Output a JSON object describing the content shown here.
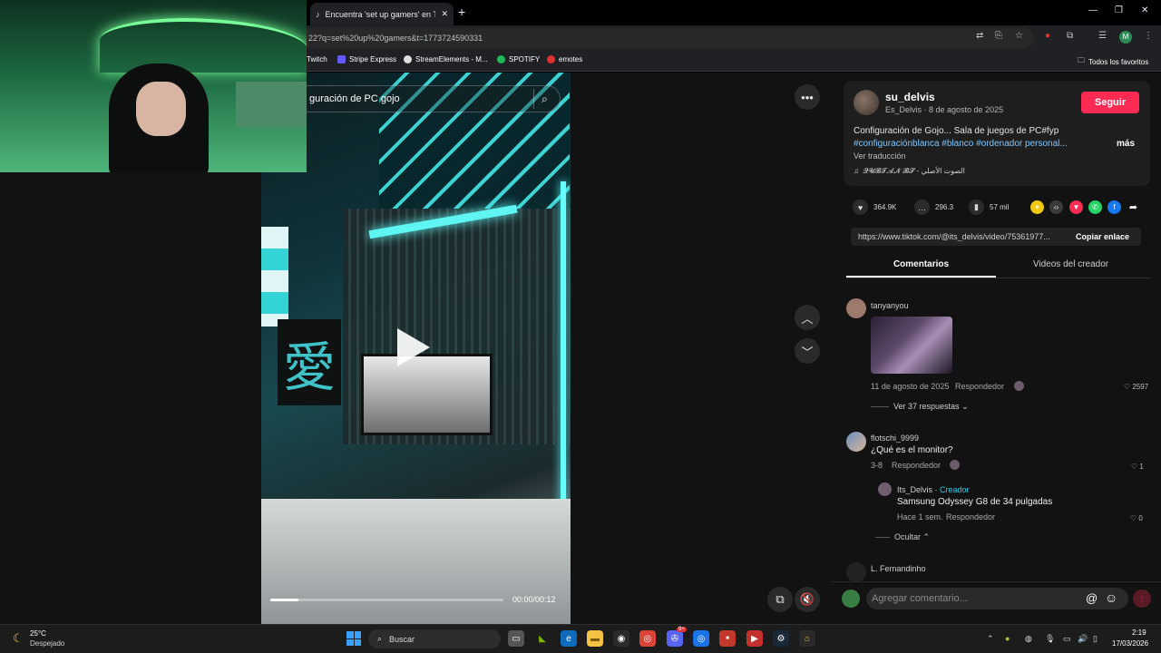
{
  "browser": {
    "tab_title": "Encuentra 'set up gamers' en Ti",
    "tab_close": "✕",
    "new_tab": "+",
    "window_controls": {
      "minimize": "—",
      "maximize": "❐",
      "close": "✕"
    },
    "url": "22?q=set%20up%20gamers&t=1773724590331",
    "bookmarks": [
      {
        "label": "Twitch",
        "color": "#9146ff"
      },
      {
        "label": "Stripe Express",
        "color": "#635bff"
      },
      {
        "label": "StreamElements - M...",
        "color": "#e0e0e0"
      },
      {
        "label": "SPOTIFY",
        "color": "#1db954"
      },
      {
        "label": "emotes",
        "color": "#e03030"
      }
    ],
    "all_favorites": "Todos los favoritos",
    "profile_initial": "M"
  },
  "video": {
    "search_text": "guración de PC gojo",
    "poster_glyph": "愛",
    "progress": 0.12,
    "time": "00:00/00:12"
  },
  "post": {
    "username": "su_delvis",
    "handle": "Es_Delvis",
    "date": "8 de agosto de 2025",
    "follow_label": "Seguir",
    "description_line1": "Configuración de Gojo... Sala de juegos de PC#fyp",
    "description_line2": "#configuraciónblanca #blanco #ordenador personal...",
    "more": "más",
    "translate": "Ver traducción",
    "music_note": "♫",
    "music": "𝓠𝓤𝓑𝓣𝓐𝓝 𝓑𝓢 - الصوت الأصلي",
    "likes": "364.9K",
    "comments": "296.3",
    "saves": "57 mil",
    "link": "https://www.tiktok.com/@its_delvis/video/75361977...",
    "copy_link": "Copiar enlace",
    "tab_comments": "Comentarios",
    "tab_videos": "Videos del creador"
  },
  "comments": [
    {
      "user": "tanyanyou",
      "date": "11 de agosto de 2025",
      "reply": "Respondedor",
      "likes": "2597",
      "view_replies": "Ver 37 respuestas"
    },
    {
      "user": "flotschi_9999",
      "text": "¿Qué es el monitor?",
      "date": "3-8",
      "reply": "Respondedor",
      "likes": "1"
    },
    {
      "user": "Its_Delvis",
      "creator_label": "Creador",
      "text": "Samsung Odyssey G8 de 34 pulgadas",
      "date": "Hace 1 sem.",
      "reply": "Respondedor",
      "likes": "0",
      "hide": "Ocultar"
    },
    {
      "user": "L. Fernandinho"
    }
  ],
  "comment_input": {
    "placeholder": "Agregar comentario...",
    "at": "@",
    "emoji": "☺"
  },
  "taskbar": {
    "temperature": "25°C",
    "weather": "Despejado",
    "search": "Buscar",
    "time": "2:19",
    "date": "17/03/2026",
    "discord_badge": "9+"
  },
  "colors": {
    "accent": "#fe2c55",
    "hashtag": "#7fc7ff",
    "creator": "#20d5ec"
  }
}
